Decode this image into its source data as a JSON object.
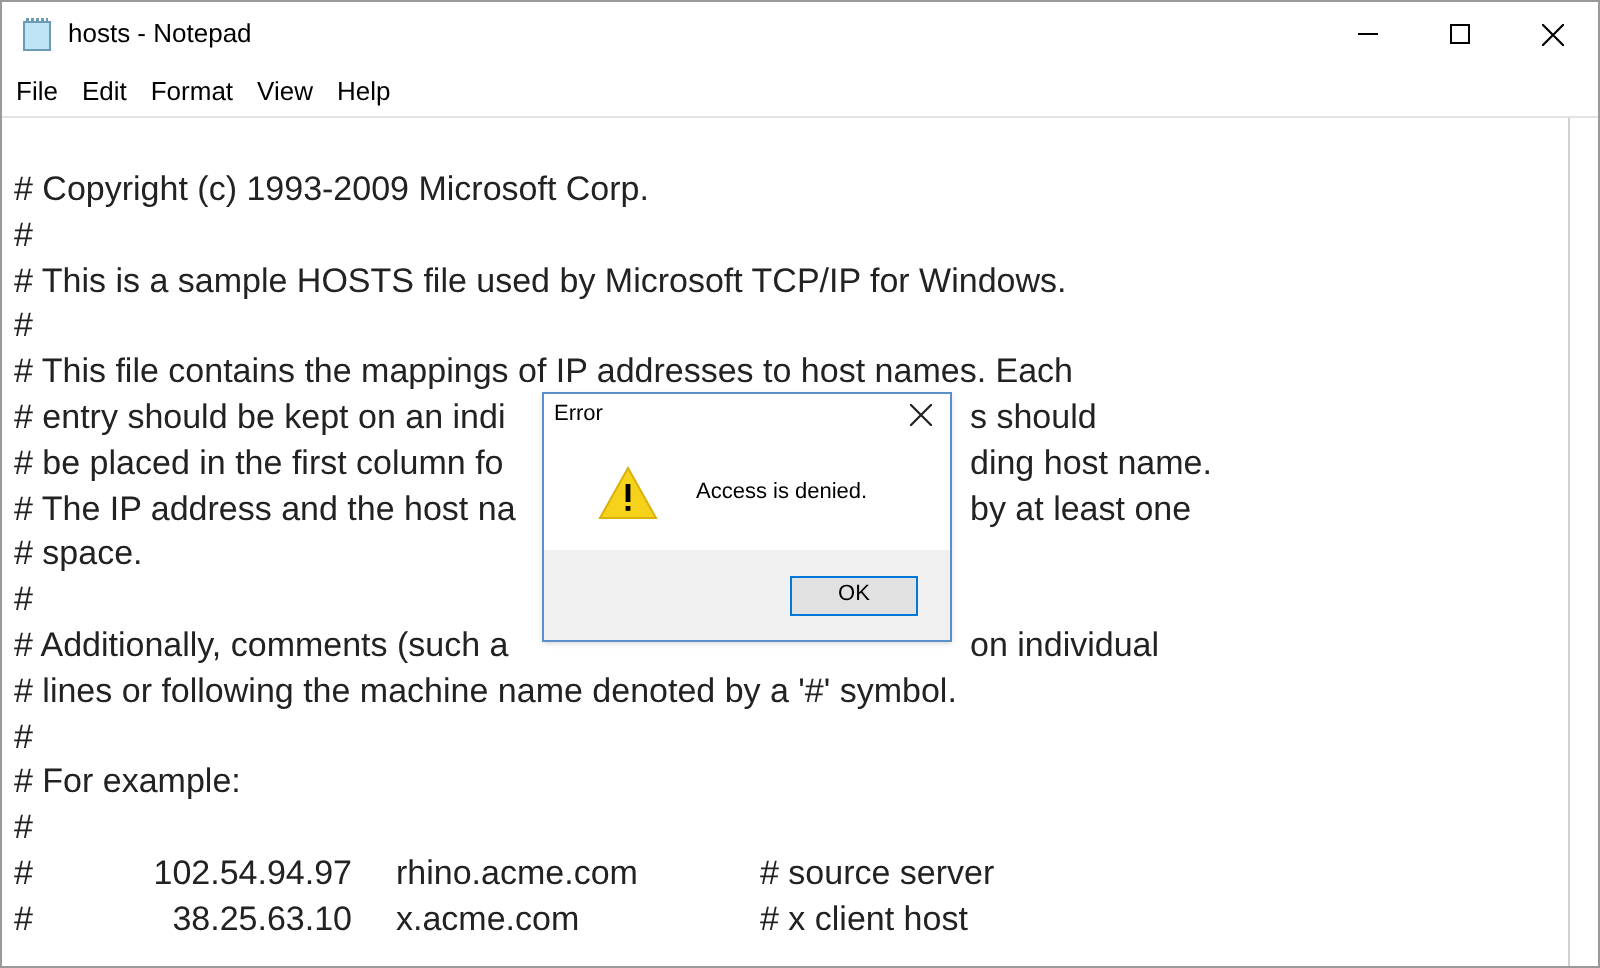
{
  "window": {
    "title": "hosts - Notepad"
  },
  "menu": [
    "File",
    "Edit",
    "Format",
    "View",
    "Help"
  ],
  "lines": [
    {
      "kind": "text",
      "segments": [
        "# Copyright (c) 1993-2009 Microsoft Corp."
      ]
    },
    {
      "kind": "text",
      "segments": [
        "#"
      ]
    },
    {
      "kind": "text",
      "segments": [
        "# This is a sample HOSTS file used by Microsoft TCP/IP for Windows."
      ]
    },
    {
      "kind": "text",
      "segments": [
        "#"
      ]
    },
    {
      "kind": "text",
      "segments": [
        "# This file contains the mappings of IP addresses to host names. Each"
      ]
    },
    {
      "kind": "split",
      "segments": [
        "# entry should be kept on an indi",
        "s should"
      ]
    },
    {
      "kind": "split",
      "segments": [
        "# be placed in the first column fo",
        "ding host name."
      ]
    },
    {
      "kind": "split",
      "segments": [
        "# The IP address and the host na",
        "by at least one"
      ]
    },
    {
      "kind": "text",
      "segments": [
        "# space."
      ]
    },
    {
      "kind": "text",
      "segments": [
        "#"
      ]
    },
    {
      "kind": "split",
      "segments": [
        "# Additionally, comments (such a",
        "on individual"
      ]
    },
    {
      "kind": "text",
      "segments": [
        "# lines or following the machine name denoted by a '#' symbol."
      ]
    },
    {
      "kind": "text",
      "segments": [
        "#"
      ]
    },
    {
      "kind": "text",
      "segments": [
        "# For example:"
      ]
    },
    {
      "kind": "text",
      "segments": [
        "#"
      ]
    },
    {
      "kind": "columns",
      "segments": [
        "#",
        "102.54.94.97",
        "rhino.acme.com",
        "# source server"
      ]
    },
    {
      "kind": "columns",
      "segments": [
        "#",
        "38.25.63.10",
        "x.acme.com",
        "# x client host"
      ]
    }
  ],
  "dialog": {
    "title": "Error",
    "message": "Access is denied.",
    "button": "OK"
  }
}
